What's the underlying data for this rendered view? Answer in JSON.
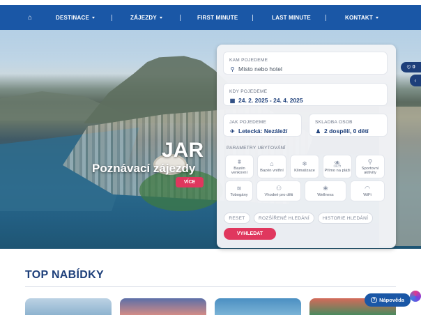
{
  "nav": {
    "home_icon": "home-icon",
    "items": [
      {
        "label": "DESTINACE",
        "has_dropdown": true
      },
      {
        "label": "ZÁJEZDY",
        "has_dropdown": true
      },
      {
        "label": "FIRST MINUTE",
        "has_dropdown": false
      },
      {
        "label": "LAST MINUTE",
        "has_dropdown": false
      },
      {
        "label": "KONTAKT",
        "has_dropdown": true
      }
    ],
    "background": "#1a57a6"
  },
  "hero": {
    "title": "JAR",
    "subtitle": "Poznávací zájezdy",
    "button": "VÍCE"
  },
  "search": {
    "destination": {
      "label": "KAM POJEDEME",
      "placeholder": "Místo nebo hotel"
    },
    "dates": {
      "label": "KDY POJEDEME",
      "value": "24. 2. 2025 - 24. 4. 2025"
    },
    "transport": {
      "label": "JAK POJEDEME",
      "value": "Letecká: Nezáleží"
    },
    "travelers": {
      "label": "SKLADBA OSOB",
      "value": "2 dospělí, 0 dětí"
    },
    "params_label": "PARAMETRY UBYTOVÁNÍ",
    "amenities": [
      {
        "label": "Bazén venkovní",
        "icon": "outdoor-pool-icon",
        "glyph": "⩩"
      },
      {
        "label": "Bazén vnitřní",
        "icon": "indoor-pool-icon",
        "glyph": "⌂"
      },
      {
        "label": "Klimatizace",
        "icon": "snowflake-icon",
        "glyph": "❄"
      },
      {
        "label": "Přímo na pláži",
        "icon": "beach-umbrella-icon",
        "glyph": "⛱"
      },
      {
        "label": "Sportovní aktivity",
        "icon": "sport-icon",
        "glyph": "⚲"
      },
      {
        "label": "Tobogány",
        "icon": "slide-icon",
        "glyph": "≋"
      },
      {
        "label": "Vhodné pro děti",
        "icon": "family-icon",
        "glyph": "⚇"
      },
      {
        "label": "Wellness",
        "icon": "lotus-icon",
        "glyph": "❀"
      },
      {
        "label": "WiFi",
        "icon": "wifi-icon",
        "glyph": "◠"
      }
    ],
    "buttons": {
      "reset": "RESET",
      "advanced": "ROZŠÍŘENÉ HLEDÁNÍ",
      "history": "HISTORIE HLEDÁNÍ",
      "search": "VYHLEDAT"
    }
  },
  "favorites": {
    "count": "0"
  },
  "top_offers": {
    "title": "TOP NABÍDKY"
  },
  "help": {
    "label": "Nápověda"
  },
  "colors": {
    "accent": "#e0375e",
    "brand": "#1d3f7a"
  }
}
